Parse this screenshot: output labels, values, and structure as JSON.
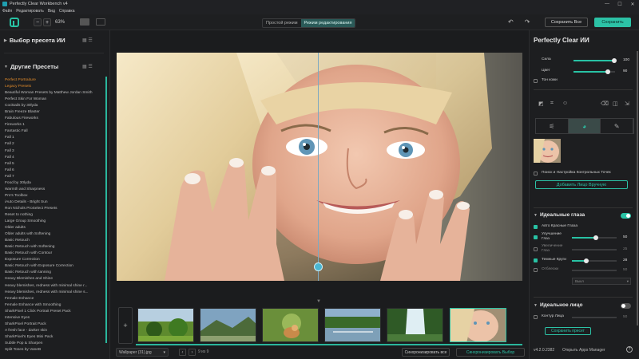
{
  "window": {
    "title": "Perfectly Clear Workbench v4",
    "controls": [
      "—",
      "☐",
      "✕"
    ]
  },
  "menu": [
    "Файл",
    "Редактировать",
    "Вид",
    "Справка"
  ],
  "toolbar": {
    "zoom_minus": "−",
    "zoom_plus": "+",
    "zoom_value": "63%",
    "mode_simple": "Простой режим",
    "mode_edit": "Режим редактирования",
    "undo": "↶",
    "redo": "↷",
    "save_all": "Сохранить Все",
    "save": "Сохранить"
  },
  "left": {
    "ai_preset_title": "Выбор пресета ИИ",
    "other_presets_title": "Другие Пресеты",
    "tree": [
      {
        "t": "Perfect Portraiture",
        "c": "orange"
      },
      {
        "t": "Legacy Presets",
        "c": "orange"
      },
      {
        "t": "Beautiful Woman Presets by Matthew Jordan Smith"
      },
      {
        "t": "    Perfect Skin For Woman"
      },
      {
        "t": "Cocktails by 30lyda"
      },
      {
        "t": "    Brain Freeze Blaster"
      },
      {
        "t": "Fabulous Fireworks"
      },
      {
        "t": "    Fireworks 1"
      },
      {
        "t": "Fantastic Fall"
      },
      {
        "t": "    Fall 1"
      },
      {
        "t": "    Fall 2"
      },
      {
        "t": "    Fall 3"
      },
      {
        "t": "    Fall 4"
      },
      {
        "t": "    Fall 5"
      },
      {
        "t": "    Fall 6"
      },
      {
        "t": "    Fall 7"
      },
      {
        "t": "Food by 30lyda"
      },
      {
        "t": "    Warmth and Sharpness"
      },
      {
        "t": "Pro's Toolbox"
      },
      {
        "t": "    iAuto Details - Bright Sun"
      },
      {
        "t": "Ron Nichols ProSelect Presets"
      },
      {
        "t": "    Reset to nothing"
      },
      {
        "t": "    Large Group Smoothing"
      },
      {
        "t": "    Older adults"
      },
      {
        "t": "    Older adults with Softening"
      },
      {
        "t": "    Basic Retouch"
      },
      {
        "t": "    Basic Retouch with Softening"
      },
      {
        "t": "    Basic Retouch with Contour"
      },
      {
        "t": "    Exposure Correction"
      },
      {
        "t": "    Basic Retouch with Exposure Correction"
      },
      {
        "t": "    Basic Retouch with tanning"
      },
      {
        "t": "    Heavy Blemishes and Shine"
      },
      {
        "t": "    Heavy blemishes, redness with minimal shine r..."
      },
      {
        "t": "    Heavy blemishes, redness with minimal shine s..."
      },
      {
        "t": "    Female Enhance"
      },
      {
        "t": "    Female Enhance with Smoothing"
      },
      {
        "t": "SharkPixel 1 Click Portrait Preset Pack"
      },
      {
        "t": "    Intensive Eyes"
      },
      {
        "t": "SharkPixel Portrait Pack"
      },
      {
        "t": "    A fresh face - darker skin"
      },
      {
        "t": "SharkPixel's Eyes Mini Pack"
      },
      {
        "t": "    Subtle Pop & Sharpen"
      },
      {
        "t": "Split Tones by VaneB"
      }
    ]
  },
  "status": {
    "file": "Wallpaper (31).jpg",
    "prev": "‹",
    "next": "›",
    "counter": "9 из 9",
    "sync_all": "Синхронизировать все",
    "sync_selected": "Синхронизировать Выбор"
  },
  "right": {
    "title": "Perfectly Clear ИИ",
    "strength_label": "Сила",
    "strength_value": "100",
    "color_label": "Цвет",
    "color_value": "90",
    "skin_tone_label": "Тон кожи",
    "face_search_label": "Поиск и Настройка Контрольных Точек",
    "add_face_button": "Добавить Лицо Вручную",
    "perfect_eyes_title": "Идеальные глаза",
    "auto_red_eye": "Авто Красные Глаза",
    "eye_enhance": "Улучшение Глаз",
    "eye_enhance_value": "50",
    "eye_enlarge": "Увеличение Глаз",
    "eye_enlarge_value": "25",
    "dark_circles": "Темные Круги",
    "dark_circles_value": "28",
    "catchlight": "Отблески",
    "catchlight_value": "50",
    "catchlight_select": "Выкл",
    "perfect_face_title": "Идеальное лицо",
    "face_contour": "Контур Лица",
    "face_contour_value": "50",
    "save_preset": "Сохранить пресет",
    "version": "v4.2.0.2382",
    "apps_manager": "Открыть Apps Manager",
    "help": "?"
  },
  "colors": {
    "accent": "#2cc2a6",
    "orange": "#e08a2a"
  },
  "icons": {
    "tab1": "⚟",
    "tab2": "◕",
    "tab3": "✎"
  }
}
